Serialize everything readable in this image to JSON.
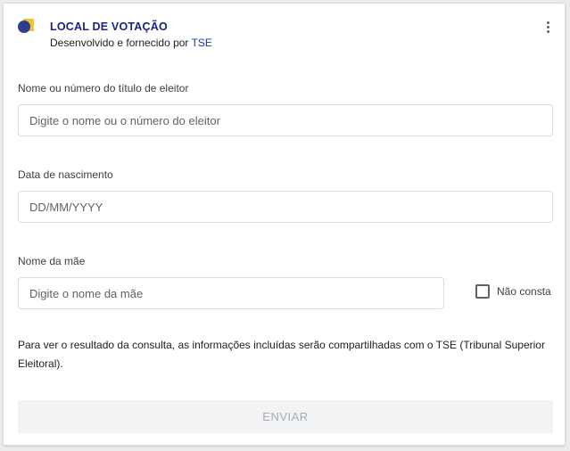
{
  "header": {
    "title": "LOCAL DE VOTAÇÃO",
    "subtitle_prefix": "Desenvolvido e fornecido por",
    "provider": "TSE",
    "logo_icon": "tse-ballot-logo-icon",
    "menu_icon": "more-vert-icon"
  },
  "form": {
    "voter": {
      "label": "Nome ou número do título de eleitor",
      "placeholder": "Digite o nome ou o número do eleitor",
      "value": ""
    },
    "birthdate": {
      "label": "Data de nascimento",
      "placeholder": "DD/MM/YYYY",
      "value": ""
    },
    "mother": {
      "label": "Nome da mãe",
      "placeholder": "Digite o nome da mãe",
      "value": ""
    },
    "not_listed": {
      "label": "Não consta",
      "checked": false
    },
    "disclaimer": "Para ver o resultado da consulta, as informações incluídas serão compartilhadas com o TSE (Tribunal Superior Eleitoral).",
    "submit_label": "ENVIAR"
  },
  "colors": {
    "title": "#1a237e",
    "provider_link": "#1a3d8f",
    "logo_blue": "#2c3e8c",
    "logo_yellow": "#f2c230",
    "submit_bg": "#f1f3f4",
    "submit_text": "#a8acb0"
  }
}
